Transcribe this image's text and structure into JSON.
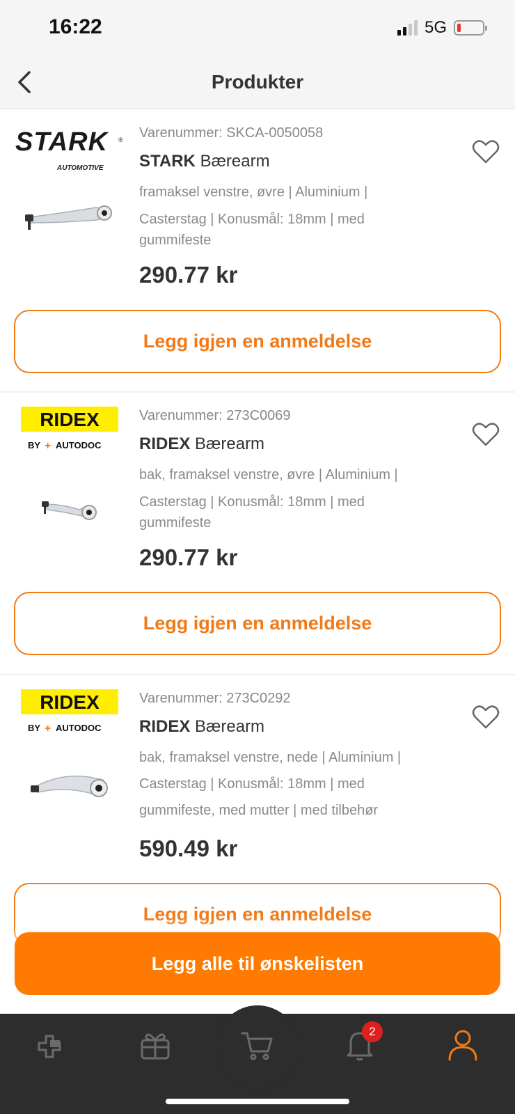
{
  "status_bar": {
    "time": "16:22",
    "network": "5G",
    "battery_level_pct": 10
  },
  "header": {
    "title": "Produkter"
  },
  "products": [
    {
      "brand_logo": "STARK AUTOMOTIVE",
      "article_no": "Varenummer: SKCA-0050058",
      "brand": "STARK",
      "name": "Bærearm",
      "desc_line1": "framaksel venstre, øvre | Aluminium |",
      "desc_line2": "Casterstag | Konusmål: 18mm | med",
      "desc_line3": "gummifeste",
      "price": "290.77 kr",
      "review_label": "Legg igjen en anmeldelse"
    },
    {
      "brand_logo": "RIDEX BY AUTODOC",
      "article_no": "Varenummer: 273C0069",
      "brand": "RIDEX",
      "name": "Bærearm",
      "desc_line1": "bak, framaksel venstre, øvre | Aluminium |",
      "desc_line2": "Casterstag | Konusmål: 18mm | med",
      "desc_line3": "gummifeste",
      "price": "290.77 kr",
      "review_label": "Legg igjen en anmeldelse"
    },
    {
      "brand_logo": "RIDEX BY AUTODOC",
      "article_no": "Varenummer: 273C0292",
      "brand": "RIDEX",
      "name": "Bærearm",
      "desc_line1": "bak, framaksel venstre, nede | Aluminium |",
      "desc_line2": "Casterstag | Konusmål: 18mm | med",
      "desc_line3": "gummifeste, med mutter | med tilbehør",
      "price": "590.49 kr",
      "review_label": "Legg igjen en anmeldelse"
    }
  ],
  "wishlist_button": "Legg alle til ønskelisten",
  "tab_bar": {
    "items": [
      "catalog-icon",
      "gift-icon",
      "cart-icon",
      "bell-icon",
      "profile-icon"
    ],
    "notification_badge": "2",
    "active_color": "#f07a18",
    "inactive_color": "#6b6b6b"
  },
  "colors": {
    "accent": "#ff7a00",
    "ridex_yellow": "#ffee00"
  }
}
